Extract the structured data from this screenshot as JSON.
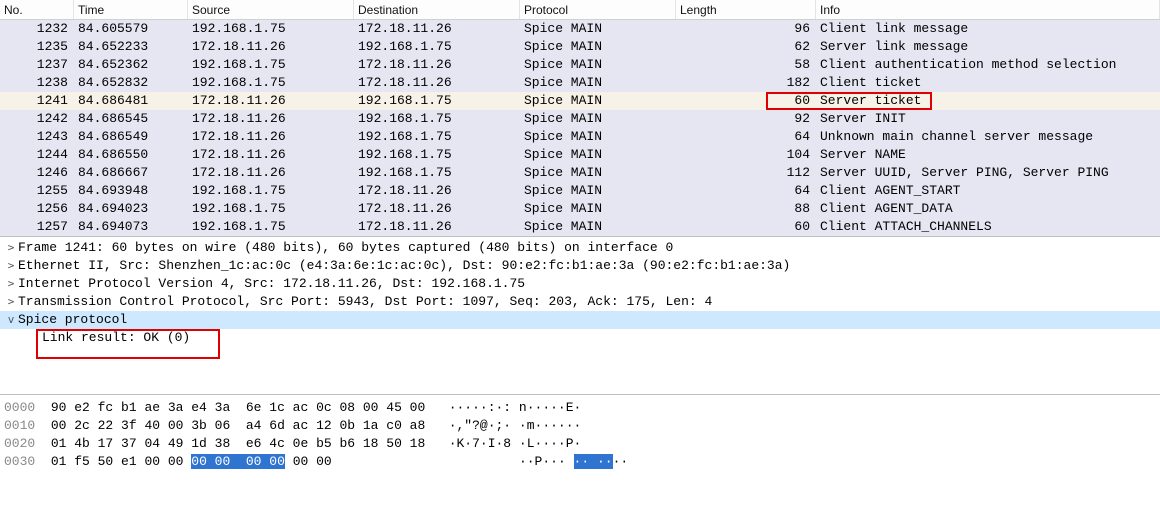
{
  "columns": {
    "no": "No.",
    "time": "Time",
    "source": "Source",
    "destination": "Destination",
    "protocol": "Protocol",
    "length": "Length",
    "info": "Info"
  },
  "packets": [
    {
      "no": "1232",
      "time": "84.605579",
      "src": "192.168.1.75",
      "dst": "172.18.11.26",
      "proto": "Spice MAIN",
      "len": "96",
      "info": "Client link message",
      "color": "purpleish"
    },
    {
      "no": "1235",
      "time": "84.652233",
      "src": "172.18.11.26",
      "dst": "192.168.1.75",
      "proto": "Spice MAIN",
      "len": "62",
      "info": "Server link message",
      "color": "purpleish"
    },
    {
      "no": "1237",
      "time": "84.652362",
      "src": "192.168.1.75",
      "dst": "172.18.11.26",
      "proto": "Spice MAIN",
      "len": "58",
      "info": "Client authentication method selection",
      "color": "purpleish"
    },
    {
      "no": "1238",
      "time": "84.652832",
      "src": "192.168.1.75",
      "dst": "172.18.11.26",
      "proto": "Spice MAIN",
      "len": "182",
      "info": "Client ticket",
      "color": "purpleish"
    },
    {
      "no": "1241",
      "time": "84.686481",
      "src": "172.18.11.26",
      "dst": "192.168.1.75",
      "proto": "Spice MAIN",
      "len": "60",
      "info": "Server ticket",
      "color": "selected"
    },
    {
      "no": "1242",
      "time": "84.686545",
      "src": "172.18.11.26",
      "dst": "192.168.1.75",
      "proto": "Spice MAIN",
      "len": "92",
      "info": "Server INIT",
      "color": "purpleish"
    },
    {
      "no": "1243",
      "time": "84.686549",
      "src": "172.18.11.26",
      "dst": "192.168.1.75",
      "proto": "Spice MAIN",
      "len": "64",
      "info": "Unknown main channel server message",
      "color": "purpleish"
    },
    {
      "no": "1244",
      "time": "84.686550",
      "src": "172.18.11.26",
      "dst": "192.168.1.75",
      "proto": "Spice MAIN",
      "len": "104",
      "info": "Server NAME",
      "color": "purpleish"
    },
    {
      "no": "1246",
      "time": "84.686667",
      "src": "172.18.11.26",
      "dst": "192.168.1.75",
      "proto": "Spice MAIN",
      "len": "112",
      "info": "Server UUID, Server PING, Server PING",
      "color": "purpleish"
    },
    {
      "no": "1255",
      "time": "84.693948",
      "src": "192.168.1.75",
      "dst": "172.18.11.26",
      "proto": "Spice MAIN",
      "len": "64",
      "info": "Client AGENT_START",
      "color": "purpleish"
    },
    {
      "no": "1256",
      "time": "84.694023",
      "src": "192.168.1.75",
      "dst": "172.18.11.26",
      "proto": "Spice MAIN",
      "len": "88",
      "info": "Client AGENT_DATA",
      "color": "purpleish"
    },
    {
      "no": "1257",
      "time": "84.694073",
      "src": "192.168.1.75",
      "dst": "172.18.11.26",
      "proto": "Spice MAIN",
      "len": "60",
      "info": "Client ATTACH_CHANNELS",
      "color": "purpleish"
    }
  ],
  "details": {
    "frame": "Frame 1241: 60 bytes on wire (480 bits), 60 bytes captured (480 bits) on interface 0",
    "ethernet": "Ethernet II, Src: Shenzhen_1c:ac:0c (e4:3a:6e:1c:ac:0c), Dst: 90:e2:fc:b1:ae:3a (90:e2:fc:b1:ae:3a)",
    "ip": "Internet Protocol Version 4, Src: 172.18.11.26, Dst: 192.168.1.75",
    "tcp": "Transmission Control Protocol, Src Port: 5943, Dst Port: 1097, Seq: 203, Ack: 175, Len: 4",
    "spice": "Spice protocol",
    "linkres": "Link result: OK (0)"
  },
  "hex": {
    "l0": {
      "off": "0000",
      "bytes": "90 e2 fc b1 ae 3a e4 3a  6e 1c ac 0c 08 00 45 00",
      "ascii": "·····:·: n·····E·"
    },
    "l1": {
      "off": "0010",
      "bytes": "00 2c 22 3f 40 00 3b 06  a4 6d ac 12 0b 1a c0 a8",
      "ascii": "·,\"?@·;· ·m······"
    },
    "l2": {
      "off": "0020",
      "bytes": "01 4b 17 37 04 49 1d 38  e6 4c 0e b5 b6 18 50 18",
      "ascii": "·K·7·I·8 ·L····P·"
    },
    "l3": {
      "off": "0030",
      "pre": "01 f5 50 e1 00 00 ",
      "sel": "00 00  00 00",
      "post": " 00 00",
      "ascii_pre": "··P··· ",
      "ascii_sel": "·· ··",
      "ascii_post": "··"
    }
  }
}
